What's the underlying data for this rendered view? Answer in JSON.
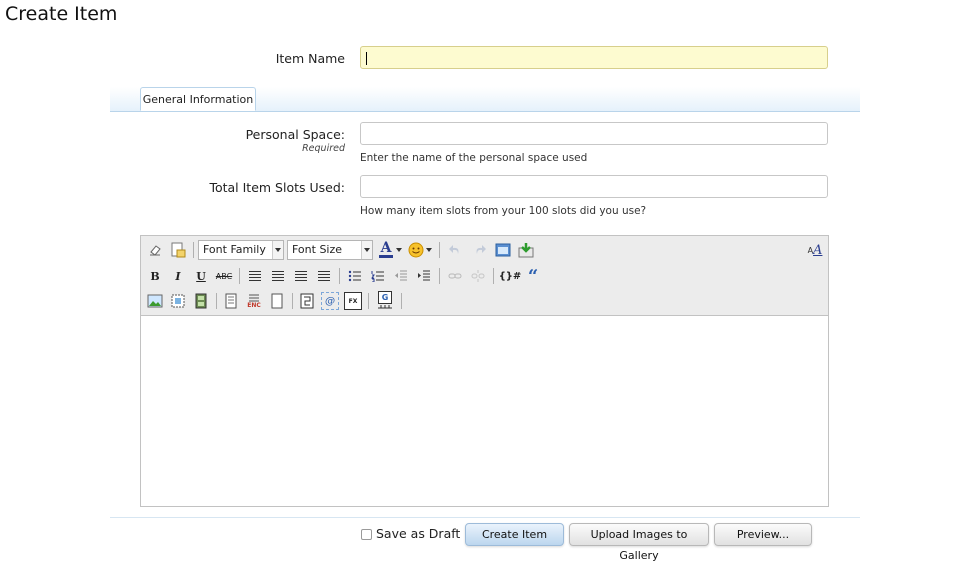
{
  "page": {
    "title": "Create Item"
  },
  "form": {
    "item_name": {
      "label": "Item Name",
      "value": ""
    },
    "tabs": [
      {
        "label": "General Information",
        "active": true
      }
    ],
    "personal_space": {
      "label": "Personal Space:",
      "required_label": "Required",
      "value": "",
      "hint": "Enter the name of the personal space used"
    },
    "total_slots": {
      "label": "Total Item Slots Used:",
      "value": "",
      "hint": "How many item slots from your 100 slots did you use?"
    }
  },
  "editor": {
    "font_family": "Font Family",
    "font_size": "Font Size",
    "content": "",
    "icons": {
      "bold": "B",
      "italic": "I",
      "underline": "U",
      "strike": "ABC",
      "enc": "ENC",
      "fx": "FX",
      "g": "G",
      "at": "@",
      "code": "{}#",
      "quote": "“",
      "text_a": "A",
      "font_scale": "AA"
    }
  },
  "footer": {
    "save_draft_label": "Save as Draft",
    "save_draft_checked": false,
    "create_button": "Create Item",
    "upload_button": "Upload Images to Gallery",
    "preview_button": "Preview..."
  }
}
